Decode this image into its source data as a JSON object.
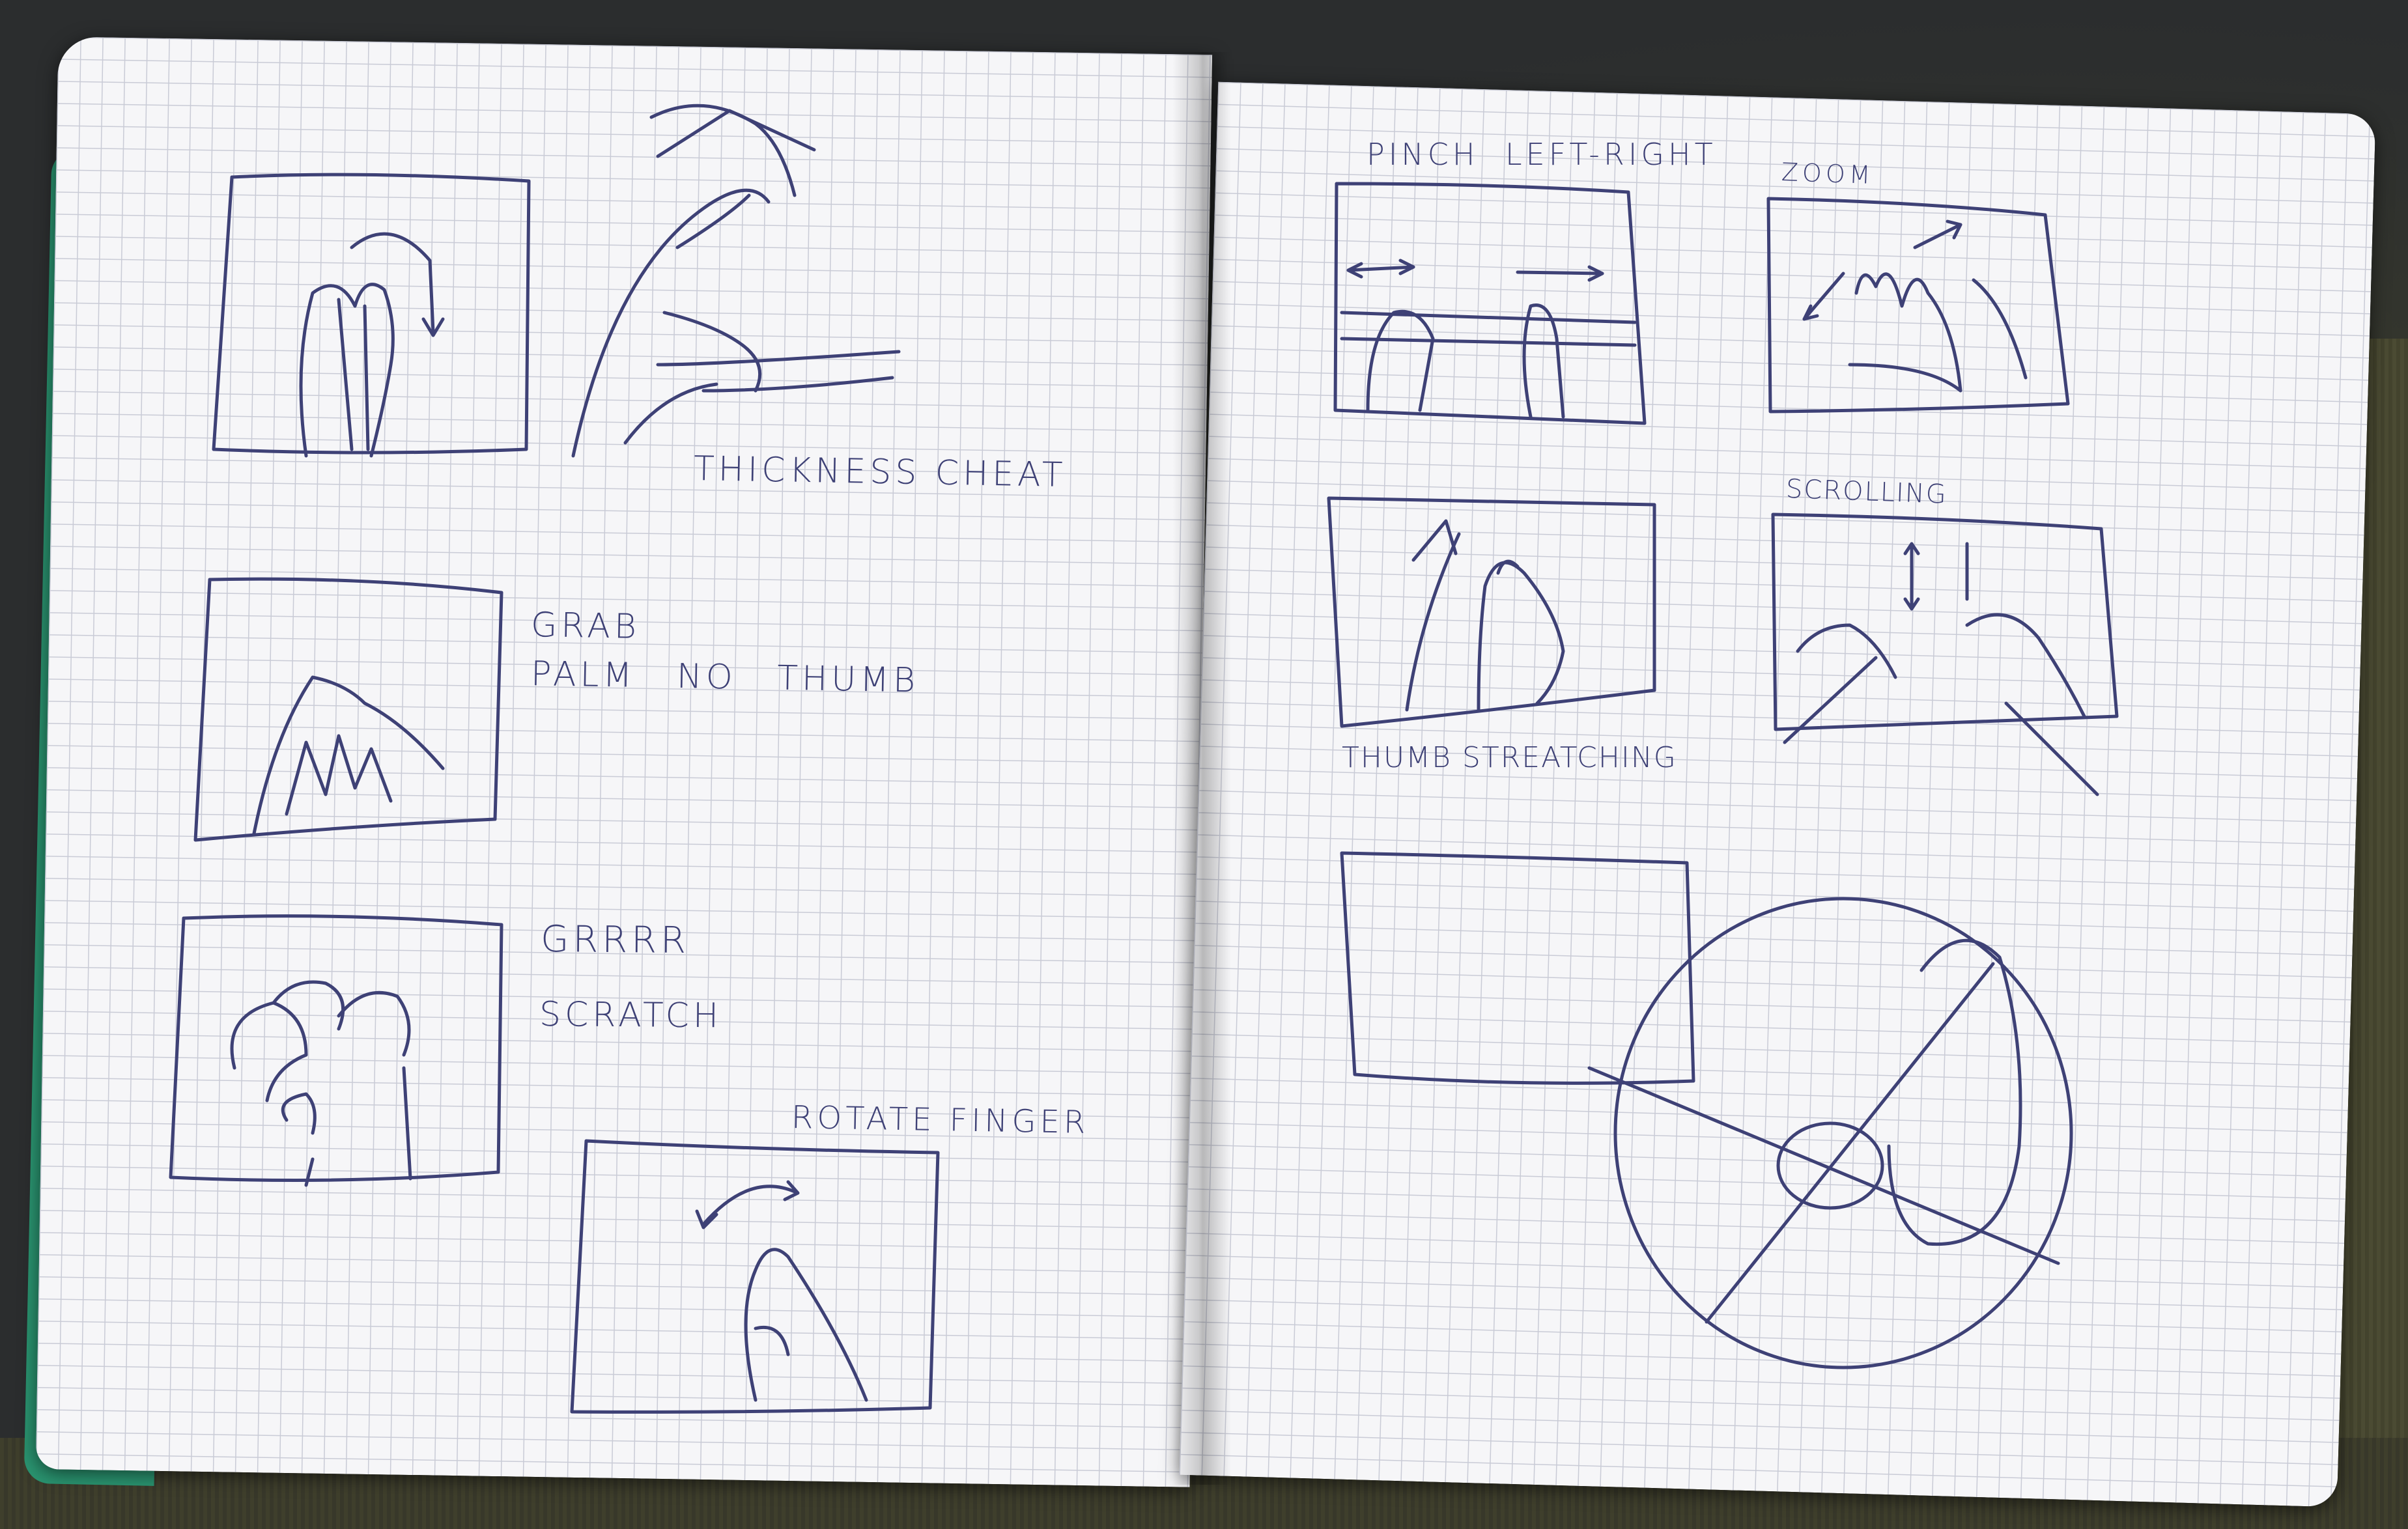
{
  "photo": {
    "subject": "notebook-spread",
    "colors": {
      "ink": "#3e4176",
      "paper": "#f6f6f8",
      "grid": "#c9cbd6",
      "cover": "#2a9470",
      "fabric": "#4b4b33"
    }
  },
  "left_page": {
    "labels": {
      "thickness_cheat": "THICKNESS CHEAT",
      "grab": "GRAB",
      "palm_no_thumb": "PALM NO THUMB",
      "grrrr": "GRRRR",
      "scratch": "SCRATCH",
      "rotate_finger": "ROTATE FINGER"
    }
  },
  "right_page": {
    "labels": {
      "pinch_left_right": "PINCH LEFT-RIGHT",
      "zoom": "ZOOM",
      "scrolling": "SCROLLING",
      "thumb_stretching": "THUMB STREATCHING"
    }
  }
}
